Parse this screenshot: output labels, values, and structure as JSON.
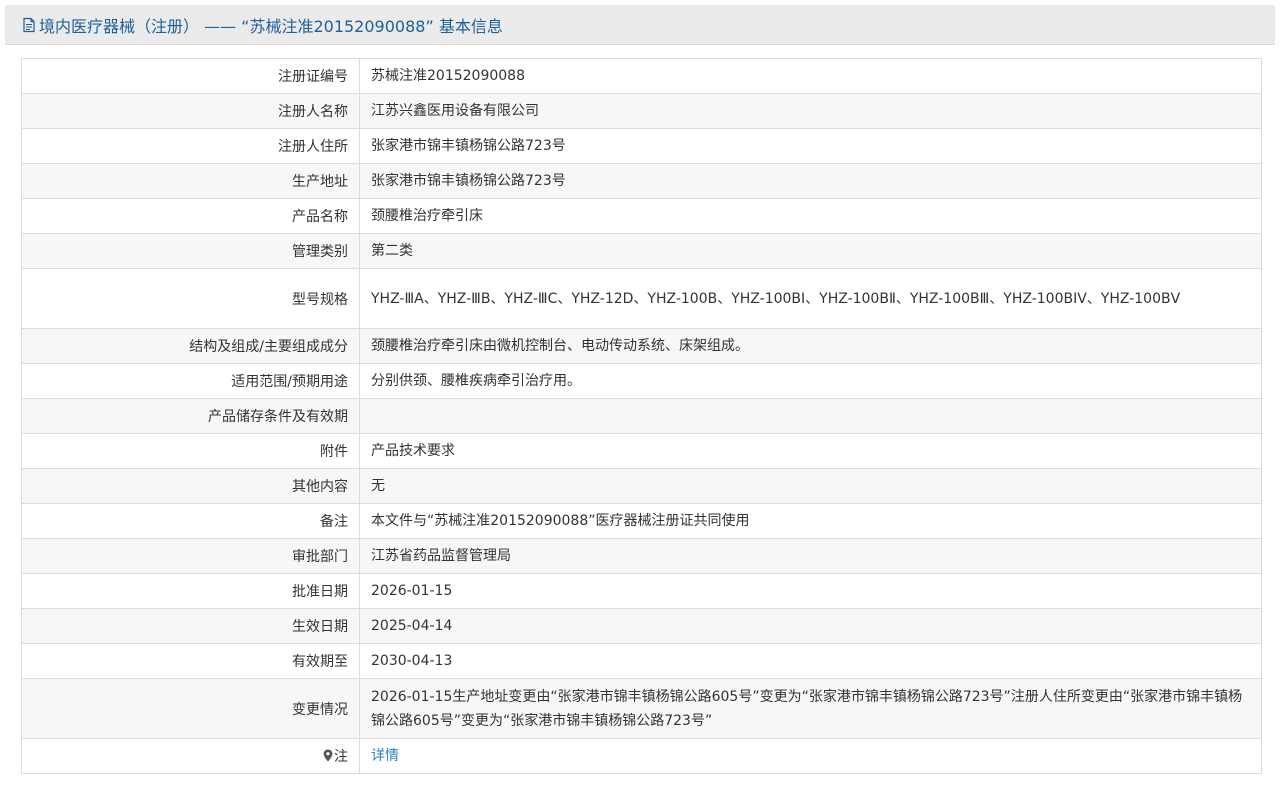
{
  "header": {
    "title": "境内医疗器械（注册） —— “苏械注准20152090088” 基本信息",
    "icon": "document-icon"
  },
  "rows": [
    {
      "label": "注册证编号",
      "value": "苏械注准20152090088"
    },
    {
      "label": "注册人名称",
      "value": "江苏兴鑫医用设备有限公司"
    },
    {
      "label": "注册人住所",
      "value": "张家港市锦丰镇杨锦公路723号"
    },
    {
      "label": "生产地址",
      "value": "张家港市锦丰镇杨锦公路723号"
    },
    {
      "label": "产品名称",
      "value": "颈腰椎治疗牵引床"
    },
    {
      "label": "管理类别",
      "value": "第二类"
    },
    {
      "label": "型号规格",
      "value": "YHZ-ⅢA、YHZ-ⅢB、YHZ-ⅢC、YHZ-12D、YHZ-100B、YHZ-100BⅠ、YHZ-100BⅡ、YHZ-100BⅢ、YHZ-100BIV、YHZ-100BⅤ"
    },
    {
      "label": "结构及组成/主要组成成分",
      "value": "颈腰椎治疗牵引床由微机控制台、电动传动系统、床架组成。"
    },
    {
      "label": "适用范围/预期用途",
      "value": "分别供颈、腰椎疾病牵引治疗用。"
    },
    {
      "label": "产品储存条件及有效期",
      "value": ""
    },
    {
      "label": "附件",
      "value": "产品技术要求"
    },
    {
      "label": "其他内容",
      "value": "无"
    },
    {
      "label": "备注",
      "value": "本文件与“苏械注准20152090088”医疗器械注册证共同使用"
    },
    {
      "label": "审批部门",
      "value": "江苏省药品监督管理局"
    },
    {
      "label": "批准日期",
      "value": "2026-01-15"
    },
    {
      "label": "生效日期",
      "value": "2025-04-14"
    },
    {
      "label": "有效期至",
      "value": "2030-04-13"
    },
    {
      "label": "变更情况",
      "value": "2026-01-15生产地址变更由“张家港市锦丰镇杨锦公路605号”变更为“张家港市锦丰镇杨锦公路723号”注册人住所变更由“张家港市锦丰镇杨锦公路605号”变更为“张家港市锦丰镇杨锦公路723号”"
    }
  ],
  "note_row": {
    "label": "注",
    "icon": "location-pin-icon",
    "link_text": "详情"
  },
  "colors": {
    "header_bg": "#ebebeb",
    "header_text": "#1f5f99",
    "link": "#2f7fc1",
    "alt_row_bg": "#f7f7f7",
    "border": "#dcdcdc"
  }
}
